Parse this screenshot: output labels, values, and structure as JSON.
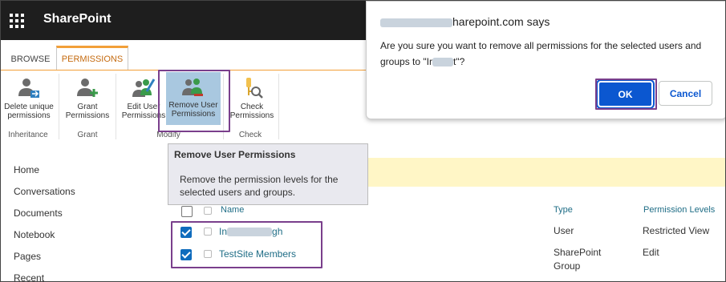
{
  "suite": {
    "brand": "SharePoint"
  },
  "ribbon": {
    "tabs": {
      "browse": "BROWSE",
      "permissions": "PERMISSIONS"
    },
    "buttons": {
      "delete_unique": "Delete unique permissions",
      "grant": "Grant Permissions",
      "edit_user": "Edit User Permissions",
      "remove_user": "Remove User Permissions",
      "check": "Check Permissions"
    },
    "groups": {
      "inheritance": "Inheritance",
      "grant": "Grant",
      "modify": "Modify",
      "check": "Check"
    }
  },
  "tooltip": {
    "title": "Remove User Permissions",
    "description": "Remove the permission levels for the selected users and groups."
  },
  "nav": [
    "Home",
    "Conversations",
    "Documents",
    "Notebook",
    "Pages",
    "Recent"
  ],
  "table": {
    "headers": {
      "name": "Name",
      "type": "Type",
      "levels": "Permission Levels"
    },
    "rows": [
      {
        "name_start": "In",
        "name_end": "gh",
        "type": "User",
        "level": "Restricted View"
      },
      {
        "name": "TestSite Members",
        "type_line1": "SharePoint",
        "type_line2": "Group",
        "level": "Edit"
      }
    ]
  },
  "dialog": {
    "origin_suffix": "harepoint.com says",
    "message_part1": "Are you sure you want to remove all permissions for the selected users and groups to \"Ir",
    "message_part2": "t\"?",
    "ok": "OK",
    "cancel": "Cancel"
  },
  "colors": {
    "accent": "#f29f38",
    "link": "#1f6d86",
    "ok_button": "#0b57d0",
    "highlight_box": "#7a3f8c"
  }
}
